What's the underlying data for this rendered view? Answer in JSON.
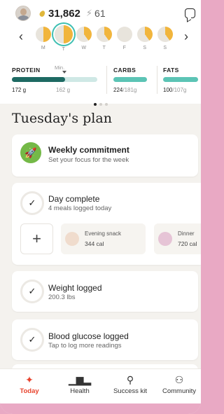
{
  "header": {
    "points": "31,862",
    "streak": "61"
  },
  "week": {
    "days": [
      {
        "label": "M",
        "progress": 0.5,
        "selected": false
      },
      {
        "label": "T",
        "progress": 0.5,
        "selected": true
      },
      {
        "label": "W",
        "progress": 0.4,
        "selected": false
      },
      {
        "label": "T",
        "progress": 0.4,
        "selected": false
      },
      {
        "label": "F",
        "progress": 0,
        "selected": false
      },
      {
        "label": "S",
        "progress": 0.4,
        "selected": false
      },
      {
        "label": "S",
        "progress": 0.4,
        "selected": false
      }
    ]
  },
  "macros": {
    "protein": {
      "label": "PROTEIN",
      "min_label": "Min.",
      "value": "172 g",
      "min_value": "162 g",
      "fill_fraction": 0.62
    },
    "carbs": {
      "label": "CARBS",
      "value": "224",
      "target": "/181g"
    },
    "fats": {
      "label": "FATS",
      "value": "100",
      "target": "/107g"
    }
  },
  "plan_title": "Tuesday's plan",
  "cards": {
    "commitment": {
      "title": "Weekly commitment",
      "subtitle": "Set your focus for the week"
    },
    "day_complete": {
      "title": "Day complete",
      "subtitle": "4 meals logged today"
    },
    "meals": [
      {
        "name": "Evening snack",
        "cal": "344 cal"
      },
      {
        "name": "Dinner",
        "cal": "720 cal"
      }
    ],
    "weight": {
      "title": "Weight logged",
      "subtitle": "200.3 lbs"
    },
    "glucose": {
      "title": "Blood glucose logged",
      "subtitle": "Tap to log more readings"
    }
  },
  "tabs": [
    {
      "label": "Today",
      "icon": "sparkle-icon",
      "active": true
    },
    {
      "label": "Health",
      "icon": "bar-chart-icon",
      "active": false
    },
    {
      "label": "Success kit",
      "icon": "lightbulb-icon",
      "active": false
    },
    {
      "label": "Community",
      "icon": "people-icon",
      "active": false
    }
  ],
  "colors": {
    "pie": "#f1b53c",
    "pie_empty": "#e8e4dc",
    "protein_bar": "#1e6a63",
    "carbs_bar": "#5cc4b5",
    "accent_active": "#e8442e",
    "rocket_bg": "#74b947"
  }
}
